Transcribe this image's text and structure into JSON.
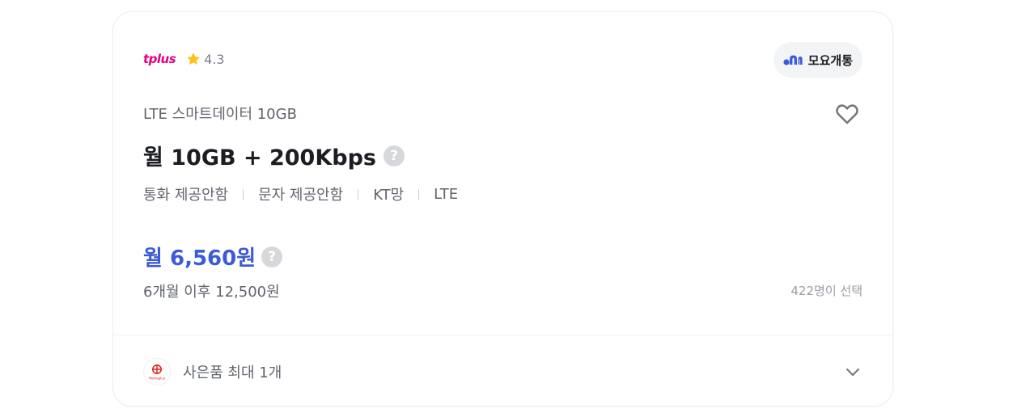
{
  "carrier": {
    "logo_text": "tplus",
    "rating": "4.3"
  },
  "badge": {
    "label": "모요개통"
  },
  "plan": {
    "name": "LTE 스마트데이터 10GB",
    "headline": "월 10GB + 200Kbps",
    "help_glyph": "?",
    "features": [
      "통화 제공안함",
      "문자 제공안함",
      "KT망",
      "LTE"
    ]
  },
  "pricing": {
    "monthly": "월 6,560원",
    "after_promo": "6개월 이후 12,500원",
    "selected_count": "422명이 선택"
  },
  "gift": {
    "logo_text": "Homeplus",
    "label": "사은품 최대 1개"
  },
  "colors": {
    "brand": "#e6007e",
    "price": "#3d5bd6",
    "badge_icon": "#3d5bd6",
    "gift_logo": "#e2231a"
  },
  "icons": {
    "star": "star-icon",
    "badge": "moyo-logo-icon",
    "heart": "heart-outline-icon",
    "help": "question-circle-icon",
    "expand": "chevron-down-icon",
    "gift_logo": "homeplus-logo-icon"
  }
}
